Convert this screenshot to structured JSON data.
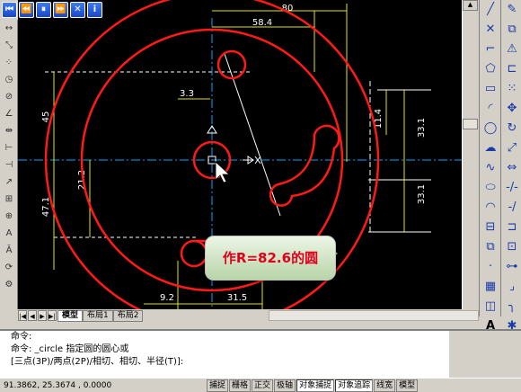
{
  "player": {
    "buttons": [
      {
        "name": "first-icon",
        "glyph": "⏮"
      },
      {
        "name": "rewind-icon",
        "glyph": "⏪"
      },
      {
        "name": "pause-icon",
        "glyph": "⏸"
      },
      {
        "name": "fast-forward-icon",
        "glyph": "⏩"
      },
      {
        "name": "close-icon",
        "glyph": "✕"
      },
      {
        "name": "info-icon",
        "glyph": "i"
      }
    ]
  },
  "drawing": {
    "dims": {
      "d80": "80",
      "d58": "58.4",
      "d3": "3.3",
      "d45": "45",
      "d21": "21.2",
      "d47": "47.1",
      "d11": "11.4",
      "d33a": "33.1",
      "d33b": "33.1",
      "d9": "9.2",
      "d31": "31.5"
    }
  },
  "callout": {
    "prefix": "作R",
    "value": "=82.6",
    "suffix": "的圆"
  },
  "tabs": {
    "model": "模型",
    "layout1": "布局1",
    "layout2": "布局2"
  },
  "command": {
    "line1": "命令:",
    "line2": "命令: _circle 指定圆的圆心或",
    "line3": "[三点(3P)/两点(2P)/相切、相切、半径(T)]:"
  },
  "status": {
    "coords": "91.3862,  25.3674 , 0.0000",
    "buttons": [
      "捕捉",
      "栅格",
      "正交",
      "极轴",
      "对象捕捉",
      "对象追踪",
      "线宽",
      "模型"
    ]
  },
  "colors": {
    "geometry": "#ff1a1a",
    "dimension": "#e6e600",
    "centerline": "#00aaff",
    "construction": "#ffffff",
    "canvas": "#000000",
    "callout_text": "#e0001c"
  }
}
